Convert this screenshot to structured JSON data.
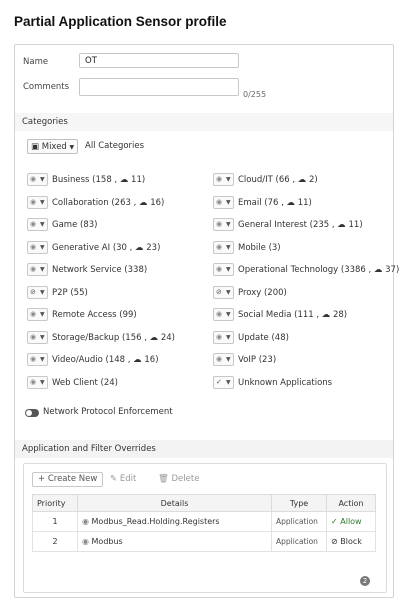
{
  "title": "Partial Application Sensor profile",
  "form": {
    "name_label": "Name",
    "name_value": "OT",
    "comments_label": "Comments",
    "comments_value": "",
    "comments_counter": "0/255"
  },
  "categories": {
    "header": "Categories",
    "all_button_label": "Mixed",
    "all_label": "All Categories",
    "left": [
      {
        "label": "Business (158 , ☁ 11)",
        "action": "monitor"
      },
      {
        "label": "Collaboration (263 , ☁ 16)",
        "action": "monitor"
      },
      {
        "label": "Game (83)",
        "action": "monitor"
      },
      {
        "label": "Generative AI (30 , ☁ 23)",
        "action": "monitor"
      },
      {
        "label": "Network Service (338)",
        "action": "monitor"
      },
      {
        "label": "P2P (55)",
        "action": "block"
      },
      {
        "label": "Remote Access (99)",
        "action": "monitor"
      },
      {
        "label": "Storage/Backup (156 , ☁ 24)",
        "action": "monitor"
      },
      {
        "label": "Video/Audio (148 , ☁ 16)",
        "action": "monitor"
      },
      {
        "label": "Web Client (24)",
        "action": "monitor"
      }
    ],
    "right": [
      {
        "label": "Cloud/IT (66 , ☁ 2)",
        "action": "monitor"
      },
      {
        "label": "Email (76 , ☁ 11)",
        "action": "monitor"
      },
      {
        "label": "General Interest (235 , ☁ 11)",
        "action": "monitor"
      },
      {
        "label": "Mobile (3)",
        "action": "monitor"
      },
      {
        "label": "Operational Technology (3386 , ☁ 37)",
        "action": "monitor"
      },
      {
        "label": "Proxy (200)",
        "action": "block"
      },
      {
        "label": "Social Media (111 , ☁ 28)",
        "action": "monitor"
      },
      {
        "label": "Update (48)",
        "action": "monitor"
      },
      {
        "label": "VoIP (23)",
        "action": "monitor"
      },
      {
        "label": "Unknown Applications",
        "action": "allow"
      }
    ]
  },
  "protocol": {
    "label": "Network Protocol Enforcement"
  },
  "overrides": {
    "header": "Application and Filter Overrides",
    "create_label": "+ Create New",
    "edit_label": "Edit",
    "delete_label": "Delete",
    "columns": [
      "Priority",
      "Details",
      "Type",
      "Action"
    ],
    "rows": [
      {
        "priority": "1",
        "details": "Modbus_Read.Holding.Registers",
        "type": "Application",
        "action": "✓ Allow"
      },
      {
        "priority": "2",
        "details": "Modbus",
        "type": "Application",
        "action": "⊘ Block"
      }
    ],
    "count": "2"
  }
}
